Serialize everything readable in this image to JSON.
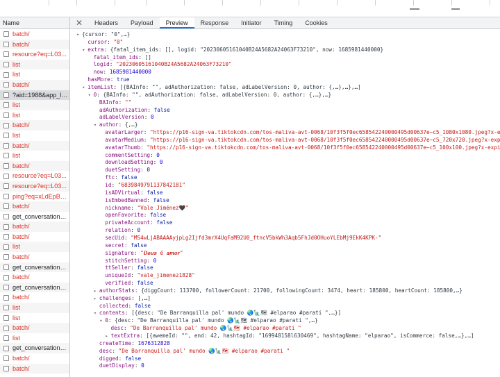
{
  "network": {
    "column_header": "Name",
    "requests": [
      {
        "name": "batch/",
        "status_color": "red"
      },
      {
        "name": "batch/",
        "status_color": "red"
      },
      {
        "name": "resource?eq=L03...",
        "status_color": "red"
      },
      {
        "name": "list",
        "status_color": "red"
      },
      {
        "name": "list",
        "status_color": "red"
      },
      {
        "name": "batch/",
        "status_color": "red"
      },
      {
        "name": "?aid=1988&app_la...",
        "status_color": "dark"
      },
      {
        "name": "list",
        "status_color": "red"
      },
      {
        "name": "list",
        "status_color": "red"
      },
      {
        "name": "batch/",
        "status_color": "red"
      },
      {
        "name": "list",
        "status_color": "red"
      },
      {
        "name": "batch/",
        "status_color": "red"
      },
      {
        "name": "list",
        "status_color": "red"
      },
      {
        "name": "batch/",
        "status_color": "red"
      },
      {
        "name": "resource?eq=L03...",
        "status_color": "red"
      },
      {
        "name": "resource?eq=L03...",
        "status_color": "red"
      },
      {
        "name": "ping?eq=xLdEpBB...",
        "status_color": "red"
      },
      {
        "name": "batch/",
        "status_color": "red"
      },
      {
        "name": "get_conversation_list",
        "status_color": "dark"
      },
      {
        "name": "batch/",
        "status_color": "red"
      },
      {
        "name": "batch/",
        "status_color": "red"
      },
      {
        "name": "list",
        "status_color": "red"
      },
      {
        "name": "batch/",
        "status_color": "red"
      },
      {
        "name": "get_conversation_list",
        "status_color": "dark"
      },
      {
        "name": "batch/",
        "status_color": "red"
      },
      {
        "name": "get_conversation_list",
        "status_color": "dark"
      },
      {
        "name": "batch/",
        "status_color": "red"
      },
      {
        "name": "list",
        "status_color": "red"
      },
      {
        "name": "list",
        "status_color": "red"
      },
      {
        "name": "batch/",
        "status_color": "red"
      },
      {
        "name": "list",
        "status_color": "red"
      },
      {
        "name": "get_conversation_list",
        "status_color": "dark"
      },
      {
        "name": "batch/",
        "status_color": "red"
      },
      {
        "name": "batch/",
        "status_color": "red"
      }
    ],
    "selected_index": 6
  },
  "detail_tabs": {
    "close_glyph": "✕",
    "items": [
      "Headers",
      "Payload",
      "Preview",
      "Response",
      "Initiator",
      "Timing",
      "Cookies"
    ],
    "active": "Preview"
  },
  "preview_lines": [
    {
      "indent": 0,
      "arrow": "down",
      "tokens": [
        [
          "p",
          "{cursor: \"0\",…}"
        ]
      ]
    },
    {
      "indent": 1,
      "arrow": "",
      "tokens": [
        [
          "k",
          "cursor"
        ],
        [
          "p",
          ": "
        ],
        [
          "s",
          "\"0\""
        ]
      ]
    },
    {
      "indent": 1,
      "arrow": "down",
      "tokens": [
        [
          "k",
          "extra"
        ],
        [
          "p",
          ": {fatal_item_ids: [], logid: \"20230605161040B24A5682A24063F73210\", now: 1685981440000}"
        ]
      ]
    },
    {
      "indent": 2,
      "arrow": "",
      "tokens": [
        [
          "k",
          "fatal_item_ids"
        ],
        [
          "p",
          ": []"
        ]
      ]
    },
    {
      "indent": 2,
      "arrow": "",
      "tokens": [
        [
          "k",
          "logid"
        ],
        [
          "p",
          ": "
        ],
        [
          "s",
          "\"20230605161040B24A5682A24063F73210\""
        ]
      ]
    },
    {
      "indent": 2,
      "arrow": "",
      "tokens": [
        [
          "k",
          "now"
        ],
        [
          "p",
          ": "
        ],
        [
          "n",
          "1685981440000"
        ]
      ]
    },
    {
      "indent": 1,
      "arrow": "",
      "tokens": [
        [
          "k",
          "hasMore"
        ],
        [
          "p",
          ": "
        ],
        [
          "b",
          "true"
        ]
      ]
    },
    {
      "indent": 1,
      "arrow": "down",
      "tokens": [
        [
          "k",
          "itemList"
        ],
        [
          "p",
          ": [{BAInfo: \"\", adAuthorization: false, adLabelVersion: 0, author: {,…},…},…]"
        ]
      ]
    },
    {
      "indent": 2,
      "arrow": "down",
      "tokens": [
        [
          "k",
          "0"
        ],
        [
          "p",
          ": {BAInfo: \"\", adAuthorization: false, adLabelVersion: 0, author: {,…},…}"
        ]
      ]
    },
    {
      "indent": 3,
      "arrow": "",
      "tokens": [
        [
          "k",
          "BAInfo"
        ],
        [
          "p",
          ": "
        ],
        [
          "s",
          "\"\""
        ]
      ]
    },
    {
      "indent": 3,
      "arrow": "",
      "tokens": [
        [
          "k",
          "adAuthorization"
        ],
        [
          "p",
          ": "
        ],
        [
          "b",
          "false"
        ]
      ]
    },
    {
      "indent": 3,
      "arrow": "",
      "tokens": [
        [
          "k",
          "adLabelVersion"
        ],
        [
          "p",
          ": "
        ],
        [
          "n",
          "0"
        ]
      ]
    },
    {
      "indent": 3,
      "arrow": "down",
      "tokens": [
        [
          "k",
          "author"
        ],
        [
          "p",
          ": {,…}"
        ]
      ]
    },
    {
      "indent": 4,
      "arrow": "",
      "tokens": [
        [
          "k",
          "avatarLarger"
        ],
        [
          "p",
          ": "
        ],
        [
          "s",
          "\"https://p16-sign-va.tiktokcdn.com/tos-maliva-avt-0068/10f3f5f0ec658542240000495d00637e~c5_1080x1080.jpeg?x-expi"
        ]
      ]
    },
    {
      "indent": 4,
      "arrow": "",
      "tokens": [
        [
          "k",
          "avatarMedium"
        ],
        [
          "p",
          ": "
        ],
        [
          "s",
          "\"https://p16-sign-va.tiktokcdn.com/tos-maliva-avt-0068/10f3f5f0ec658542240000495d00637e~c5_720x720.jpeg?x-expi"
        ]
      ]
    },
    {
      "indent": 4,
      "arrow": "",
      "tokens": [
        [
          "k",
          "avatarThumb"
        ],
        [
          "p",
          ": "
        ],
        [
          "s",
          "\"https://p16-sign-va.tiktokcdn.com/tos-maliva-avt-0068/10f3f5f0ec658542240000495d00637e~c5_100x100.jpeg?x-expir"
        ]
      ]
    },
    {
      "indent": 4,
      "arrow": "",
      "tokens": [
        [
          "k",
          "commentSetting"
        ],
        [
          "p",
          ": "
        ],
        [
          "n",
          "0"
        ]
      ]
    },
    {
      "indent": 4,
      "arrow": "",
      "tokens": [
        [
          "k",
          "downloadSetting"
        ],
        [
          "p",
          ": "
        ],
        [
          "n",
          "0"
        ]
      ]
    },
    {
      "indent": 4,
      "arrow": "",
      "tokens": [
        [
          "k",
          "duetSetting"
        ],
        [
          "p",
          ": "
        ],
        [
          "n",
          "0"
        ]
      ]
    },
    {
      "indent": 4,
      "arrow": "",
      "tokens": [
        [
          "k",
          "ftc"
        ],
        [
          "p",
          ": "
        ],
        [
          "b",
          "false"
        ]
      ]
    },
    {
      "indent": 4,
      "arrow": "",
      "tokens": [
        [
          "k",
          "id"
        ],
        [
          "p",
          ": "
        ],
        [
          "s",
          "\"6839849791137842181\""
        ]
      ]
    },
    {
      "indent": 4,
      "arrow": "",
      "tokens": [
        [
          "k",
          "isADVirtual"
        ],
        [
          "p",
          ": "
        ],
        [
          "b",
          "false"
        ]
      ]
    },
    {
      "indent": 4,
      "arrow": "",
      "tokens": [
        [
          "k",
          "isEmbedBanned"
        ],
        [
          "p",
          ": "
        ],
        [
          "b",
          "false"
        ]
      ]
    },
    {
      "indent": 4,
      "arrow": "",
      "tokens": [
        [
          "k",
          "nickname"
        ],
        [
          "p",
          ": "
        ],
        [
          "s",
          "\"Vale Jiménez🖤\""
        ]
      ]
    },
    {
      "indent": 4,
      "arrow": "",
      "tokens": [
        [
          "k",
          "openFavorite"
        ],
        [
          "p",
          ": "
        ],
        [
          "b",
          "false"
        ]
      ]
    },
    {
      "indent": 4,
      "arrow": "",
      "tokens": [
        [
          "k",
          "privateAccount"
        ],
        [
          "p",
          ": "
        ],
        [
          "b",
          "false"
        ]
      ]
    },
    {
      "indent": 4,
      "arrow": "",
      "tokens": [
        [
          "k",
          "relation"
        ],
        [
          "p",
          ": "
        ],
        [
          "n",
          "0"
        ]
      ]
    },
    {
      "indent": 4,
      "arrow": "",
      "tokens": [
        [
          "k",
          "secUid"
        ],
        [
          "p",
          ": "
        ],
        [
          "s",
          "\"MS4wLjABAAAAyjpLg2Ijfd3mrX4UqFaM92U0_ftncV5bkWh3Aqb5FhJd0OHuoYLEbMj9EkK4KPK-\""
        ]
      ]
    },
    {
      "indent": 4,
      "arrow": "",
      "tokens": [
        [
          "k",
          "secret"
        ],
        [
          "p",
          ": "
        ],
        [
          "b",
          "false"
        ]
      ]
    },
    {
      "indent": 4,
      "arrow": "",
      "tokens": [
        [
          "k",
          "signature"
        ],
        [
          "p",
          ": "
        ],
        [
          "s",
          "\"𝑫𝒆𝒖𝒔 é 𝒂𝒎𝒐𝒓\""
        ]
      ]
    },
    {
      "indent": 4,
      "arrow": "",
      "tokens": [
        [
          "k",
          "stitchSetting"
        ],
        [
          "p",
          ": "
        ],
        [
          "n",
          "0"
        ]
      ]
    },
    {
      "indent": 4,
      "arrow": "",
      "tokens": [
        [
          "k",
          "ttSeller"
        ],
        [
          "p",
          ": "
        ],
        [
          "b",
          "false"
        ]
      ]
    },
    {
      "indent": 4,
      "arrow": "",
      "tokens": [
        [
          "k",
          "uniqueId"
        ],
        [
          "p",
          ": "
        ],
        [
          "s",
          "\"vale_jimenez1828\""
        ]
      ]
    },
    {
      "indent": 4,
      "arrow": "",
      "tokens": [
        [
          "k",
          "verified"
        ],
        [
          "p",
          ": "
        ],
        [
          "b",
          "false"
        ]
      ]
    },
    {
      "indent": 3,
      "arrow": "right",
      "tokens": [
        [
          "k",
          "authorStats"
        ],
        [
          "p",
          ": {diggCount: 113700, followerCount: 21700, followingCount: 3474, heart: 185800, heartCount: 185800,…}"
        ]
      ]
    },
    {
      "indent": 3,
      "arrow": "right",
      "tokens": [
        [
          "k",
          "challenges"
        ],
        [
          "p",
          ": [,…]"
        ]
      ]
    },
    {
      "indent": 3,
      "arrow": "",
      "tokens": [
        [
          "k",
          "collected"
        ],
        [
          "p",
          ": "
        ],
        [
          "b",
          "false"
        ]
      ]
    },
    {
      "indent": 3,
      "arrow": "down",
      "tokens": [
        [
          "k",
          "contents"
        ],
        [
          "p",
          ": [{desc: \"De Barranquilla pal' mundo 🌏🗽🗺 #elparao #parati \",…}]"
        ]
      ]
    },
    {
      "indent": 4,
      "arrow": "down",
      "tokens": [
        [
          "k",
          "0"
        ],
        [
          "p",
          ": {desc: \"De Barranquilla pal' mundo 🌏🗽🗺 #elparao #parati \",…}"
        ]
      ]
    },
    {
      "indent": 5,
      "arrow": "",
      "tokens": [
        [
          "k",
          "desc"
        ],
        [
          "p",
          ": "
        ],
        [
          "s",
          "\"De Barranquilla pal' mundo 🌏🗽🗺 #elparao #parati \""
        ]
      ]
    },
    {
      "indent": 5,
      "arrow": "right",
      "tokens": [
        [
          "k",
          "textExtra"
        ],
        [
          "p",
          ": [{awemeId: \"\", end: 42, hashtagId: \"169948158l630469\", hashtagName: \"elparao\", isCommerce: false,…},…]"
        ]
      ]
    },
    {
      "indent": 3,
      "arrow": "",
      "tokens": [
        [
          "k",
          "createTime"
        ],
        [
          "p",
          ": "
        ],
        [
          "n",
          "1676312828"
        ]
      ]
    },
    {
      "indent": 3,
      "arrow": "",
      "tokens": [
        [
          "k",
          "desc"
        ],
        [
          "p",
          ": "
        ],
        [
          "s",
          "\"De Barranquilla pal' mundo 🌏🗽🗺 #elparao #parati \""
        ]
      ]
    },
    {
      "indent": 3,
      "arrow": "",
      "tokens": [
        [
          "k",
          "digged"
        ],
        [
          "p",
          ": "
        ],
        [
          "b",
          "false"
        ]
      ]
    },
    {
      "indent": 3,
      "arrow": "",
      "tokens": [
        [
          "k",
          "duetDisplay"
        ],
        [
          "p",
          ": "
        ],
        [
          "n",
          "0"
        ]
      ]
    }
  ]
}
